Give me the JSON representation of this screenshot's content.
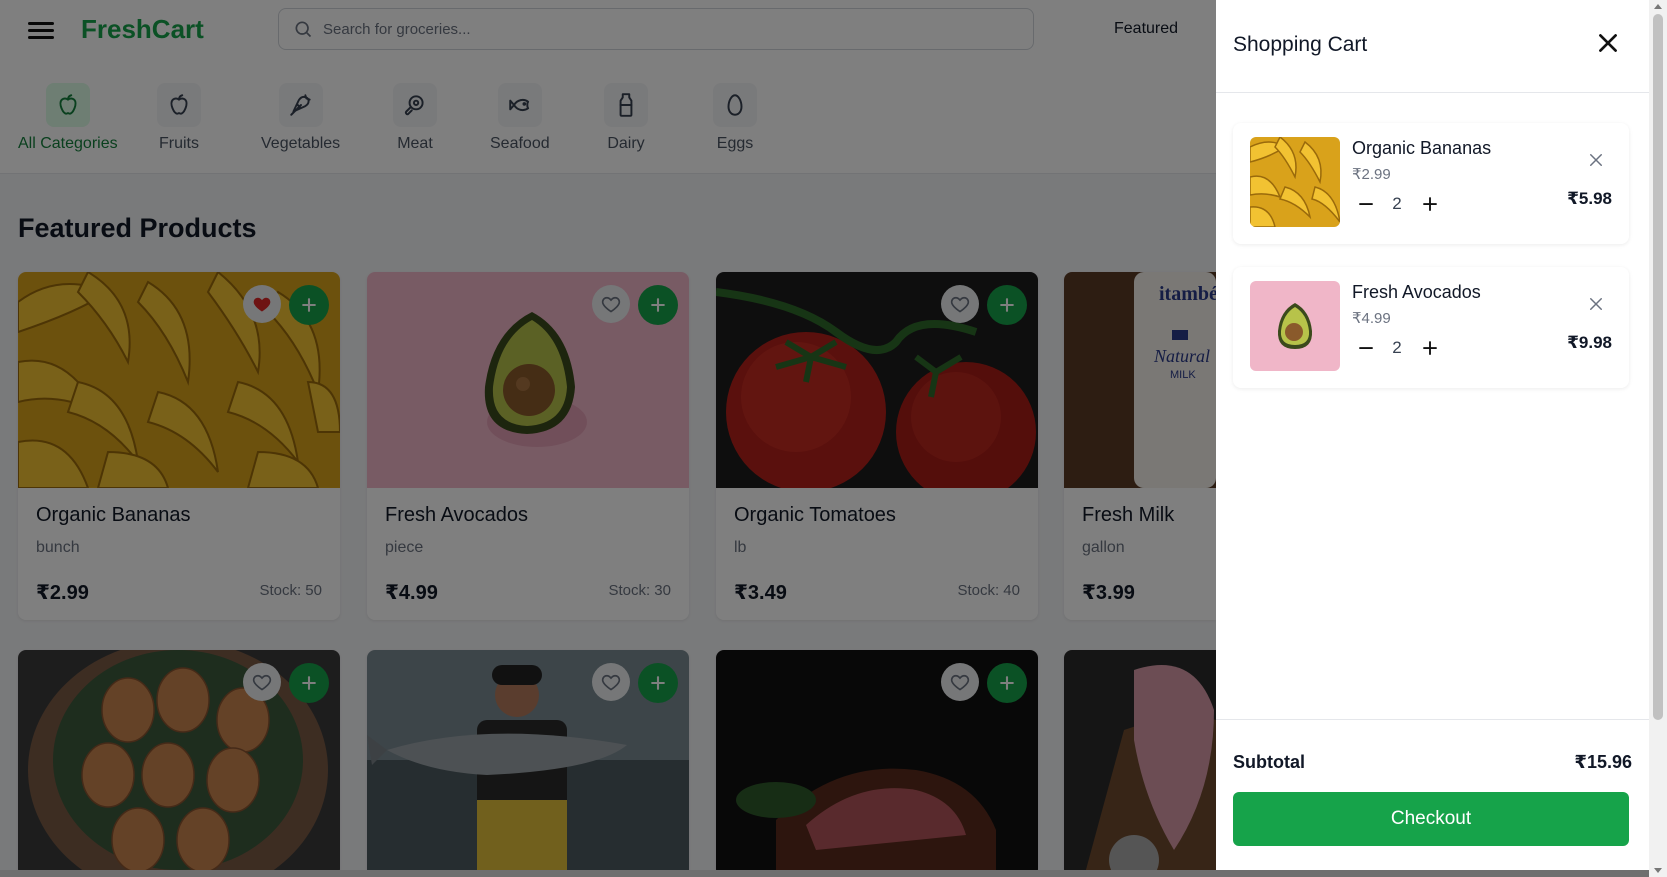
{
  "header": {
    "logo": "FreshCart",
    "search_placeholder": "Search for groceries...",
    "nav_featured": "Featured"
  },
  "categories": [
    {
      "label": "All Categories",
      "icon": "apple-icon",
      "active": true
    },
    {
      "label": "Fruits",
      "icon": "apple-icon"
    },
    {
      "label": "Vegetables",
      "icon": "carrot-icon"
    },
    {
      "label": "Meat",
      "icon": "beef-icon"
    },
    {
      "label": "Seafood",
      "icon": "fish-icon"
    },
    {
      "label": "Dairy",
      "icon": "milk-icon"
    },
    {
      "label": "Eggs",
      "icon": "egg-icon"
    }
  ],
  "section_title": "Featured Products",
  "products": [
    {
      "name": "Organic Bananas",
      "unit": "bunch",
      "price": "₹2.99",
      "stock": "Stock: 50",
      "favorited": true,
      "image": "bananas"
    },
    {
      "name": "Fresh Avocados",
      "unit": "piece",
      "price": "₹4.99",
      "stock": "Stock: 30",
      "favorited": false,
      "image": "avocado"
    },
    {
      "name": "Organic Tomatoes",
      "unit": "lb",
      "price": "₹3.49",
      "stock": "Stock: 40",
      "favorited": false,
      "image": "tomatoes"
    },
    {
      "name": "Fresh Milk",
      "unit": "gallon",
      "price": "₹3.99",
      "stock": "",
      "favorited": false,
      "image": "milk"
    }
  ],
  "products_row2": [
    {
      "image": "eggs"
    },
    {
      "image": "salmon"
    },
    {
      "image": "steak"
    },
    {
      "image": "raw-meat"
    }
  ],
  "cart": {
    "title": "Shopping Cart",
    "items": [
      {
        "name": "Organic Bananas",
        "unit_price": "₹2.99",
        "qty": "2",
        "total": "₹5.98",
        "image": "bananas"
      },
      {
        "name": "Fresh Avocados",
        "unit_price": "₹4.99",
        "qty": "2",
        "total": "₹9.98",
        "image": "avocado"
      }
    ],
    "subtotal_label": "Subtotal",
    "subtotal_value": "₹15.96",
    "checkout_label": "Checkout"
  },
  "colors": {
    "brand": "#16a34a",
    "overlay": "rgba(0,0,0,0.5)",
    "heart_active": "#dc2626"
  }
}
